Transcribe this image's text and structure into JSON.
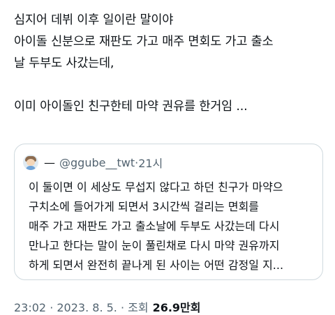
{
  "tweet": {
    "lines": [
      "심지어 데뷔 이후 일이란 말이야",
      "아이돌 신분으로 재판도 가고 매주 면회도 가고 출소",
      "날 두부도 사갔는데,",
      "이미 아이돌인 친구한테 마약 권유를 한거임 ..."
    ]
  },
  "quote": {
    "display_name": "—",
    "handle": "@ggube__twt",
    "separator": "·",
    "time": "21시",
    "lines": [
      "이 둘이면 이 세상도 무섭지 않다고 하던 친구가 마약으",
      "구치소에 들어가게 되면서 3시간씩 걸리는 면회를",
      "매주 가고 재판도 가고 출소날에 두부도 사갔는데 다시",
      "만나고 한다는 말이 눈이 풀린채로 다시 마약 권유까지",
      "하게 되면서 완전히 끝나게 된 사이는 어떤 감정일 지..."
    ]
  },
  "meta": {
    "timestamp": "23:02 · 2023. 8. 5. · 조회",
    "views": "26.9만회"
  }
}
